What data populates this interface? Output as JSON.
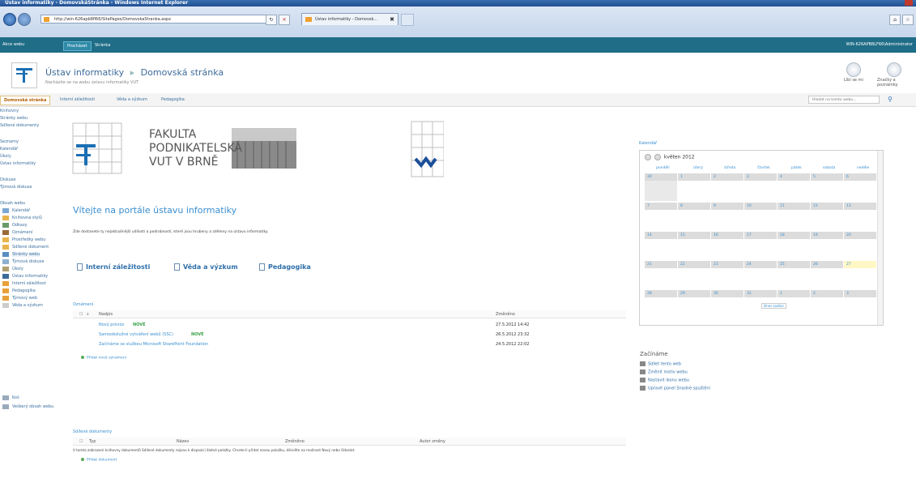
{
  "browser": {
    "window_title": "Ústav informatiky - DomovskáStránka - Windows Internet Explorer",
    "url": "http://win-626apb8fl66/SitePages/DomovskaStranka.aspx",
    "tab_title": "Ústav informatiky - Domovsk...",
    "tab_close": "✖"
  },
  "ribbon": {
    "site_actions": "Akce webu",
    "tabs": [
      "Procházet",
      "Stránka"
    ],
    "user": "WIN-626APB8LF66\\Administrator"
  },
  "header": {
    "site_title": "Ústav informatiky",
    "separator": "▸",
    "page_title": "Domovská stránka",
    "subtitle": "Nacházíte se na webu ústavu informatiky VUT",
    "actions": [
      "Líbí se mi",
      "Značky a poznámky"
    ]
  },
  "topnav": {
    "items": [
      "Domovská stránka",
      "Interní záležitosti",
      "Věda a výzkum",
      "Pedagogika"
    ],
    "search_placeholder": "Hledat na tomto webu..."
  },
  "leftnav": {
    "g1": "Knihovny",
    "g1_items": [
      "Stránky webu",
      "Sdílené dokumenty"
    ],
    "g2": "Seznamy",
    "g2_items": [
      "Kalendář",
      "Úkoly",
      "Ústav informatiky"
    ],
    "g3": "Diskuse",
    "g3_items": [
      "Týmová diskuse"
    ],
    "g4": "Obsah webu",
    "g4_items": [
      "Kalendář",
      "Knihovna stylů",
      "Odkazy",
      "Oznámení",
      "Prostředky webu",
      "Sdílené dokument",
      "Stránky webu",
      "Týmová diskuse",
      "Úkoly",
      "Ústav informatiky",
      "Interní záležitost",
      "Pedagogika",
      "Týmový web",
      "Věda a výzkum"
    ],
    "recycle": "Koš",
    "all_content": "Veškerý obsah webu"
  },
  "banner": {
    "line1": "FAKULTA",
    "line2": "PODNIKATELSKÁ",
    "line3": "VUT V BRNĚ"
  },
  "main": {
    "welcome": "Vítejte na portále ústavu informatiky",
    "desc": "Zde dostanete ty nejaktuálnější udílosti a podrobnosti, které jsou hrubeny a zděleny na ústavu informatiky.",
    "quicklinks": [
      "Interní záležitosti",
      "Věda a výzkum",
      "Pedagogika"
    ]
  },
  "announcements": {
    "title": "Oznámení",
    "col_title": "Nadpis",
    "col_modified": "Změněno",
    "rows": [
      {
        "title": "Nový provoz",
        "new": "NOVÉ",
        "modified": "27.5.2012 14:42"
      },
      {
        "title": "Samoobslužné vytváření webů (SSC)",
        "new": "NOVÉ",
        "modified": "26.5.2012 23:32"
      },
      {
        "title": "Začínáme se službou Microsoft SharePoint Foundation",
        "new": "",
        "modified": "24.5.2012 22:02"
      }
    ],
    "add": "Přidat nové oznámení"
  },
  "docs": {
    "title": "Sdílené dokumenty",
    "cols": [
      "Typ",
      "Název",
      "Změněno",
      "Autor změny"
    ],
    "empty_msg": "V tomto zobrazení knihovny dokumentů Sdílené dokumenty nejsou k dispozici žádné položky. Chcete-li přidat novou položku, klikněte na možnost Nový nebo Odeslat.",
    "add": "Přidat dokument"
  },
  "calendar": {
    "title": "Kalendář",
    "month": "květen 2012",
    "days": [
      "pondělí",
      "úterý",
      "středa",
      "čtvrtek",
      "pátek",
      "sobota",
      "neděle"
    ],
    "weeks": [
      [
        "30",
        "1",
        "2",
        "3",
        "4",
        "5",
        "6"
      ],
      [
        "7",
        "8",
        "9",
        "10",
        "11",
        "12",
        "13"
      ],
      [
        "14",
        "15",
        "16",
        "17",
        "18",
        "19",
        "20"
      ],
      [
        "21",
        "22",
        "23",
        "24",
        "25",
        "26",
        "27"
      ],
      [
        "28",
        "29",
        "30",
        "31",
        "1",
        "2",
        "3"
      ]
    ],
    "today_tag": "Dnes zadání"
  },
  "getting_started": {
    "title": "Začínáme",
    "items": [
      "Sdílet tento web",
      "Změnit motiv webu",
      "Nastavit ikonu webu",
      "Upravit panel Snadné spuštění"
    ]
  },
  "colors": {
    "ribbon": "#1f6d86",
    "accent_link": "#3a8fd0",
    "brand_blue": "#1b6fb3"
  }
}
